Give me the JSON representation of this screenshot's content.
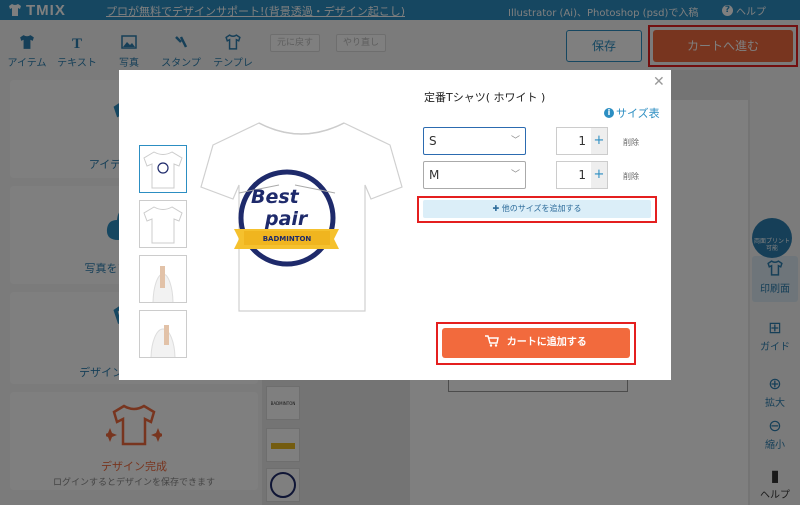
{
  "header": {
    "logo_text": "TMIX",
    "promo": "プロが無料でデザインサポート!(背景透過・デザイン起こし)",
    "import_text": "Illustrator (Ai)、Photoshop (psd)で入稿",
    "help": "ヘルプ"
  },
  "toolbar": {
    "tabs": [
      "アイテム",
      "テキスト",
      "写真",
      "スタンプ",
      "テンプレ"
    ],
    "undo": "元に戻す",
    "redo": "やり直し",
    "save": "保存",
    "cart": "カートへ進む"
  },
  "left_panel": {
    "item_check": "アイテム確認·変更",
    "upload_photo": "写真をアップロード",
    "design_template": "デザインテンプレート",
    "design_done": "デザイン完成",
    "design_done_sub": "ログインするとデザインを保存できます"
  },
  "right_rail": {
    "badge": "両面プリント可能",
    "print_side": "印刷面",
    "guide": "ガイド",
    "zoom_in": "拡大",
    "zoom_out": "縮小",
    "help": "ヘルプ"
  },
  "modal": {
    "product_title": "定番Tシャツ( ホワイト )",
    "size_chart": "サイズ表",
    "rows": [
      {
        "size": "S",
        "qty": "1",
        "delete": "削除"
      },
      {
        "size": "M",
        "qty": "1",
        "delete": "削除"
      }
    ],
    "add_size": "✚ 他のサイズを追加する",
    "add_to_cart": "カートに追加する",
    "design": {
      "line1": "Best",
      "line2": "pair",
      "ribbon": "BADMINTON"
    }
  },
  "colors": {
    "brand_blue": "#2c8ec2",
    "accent_orange": "#f06b3f",
    "highlight_red": "#e41f1f"
  }
}
